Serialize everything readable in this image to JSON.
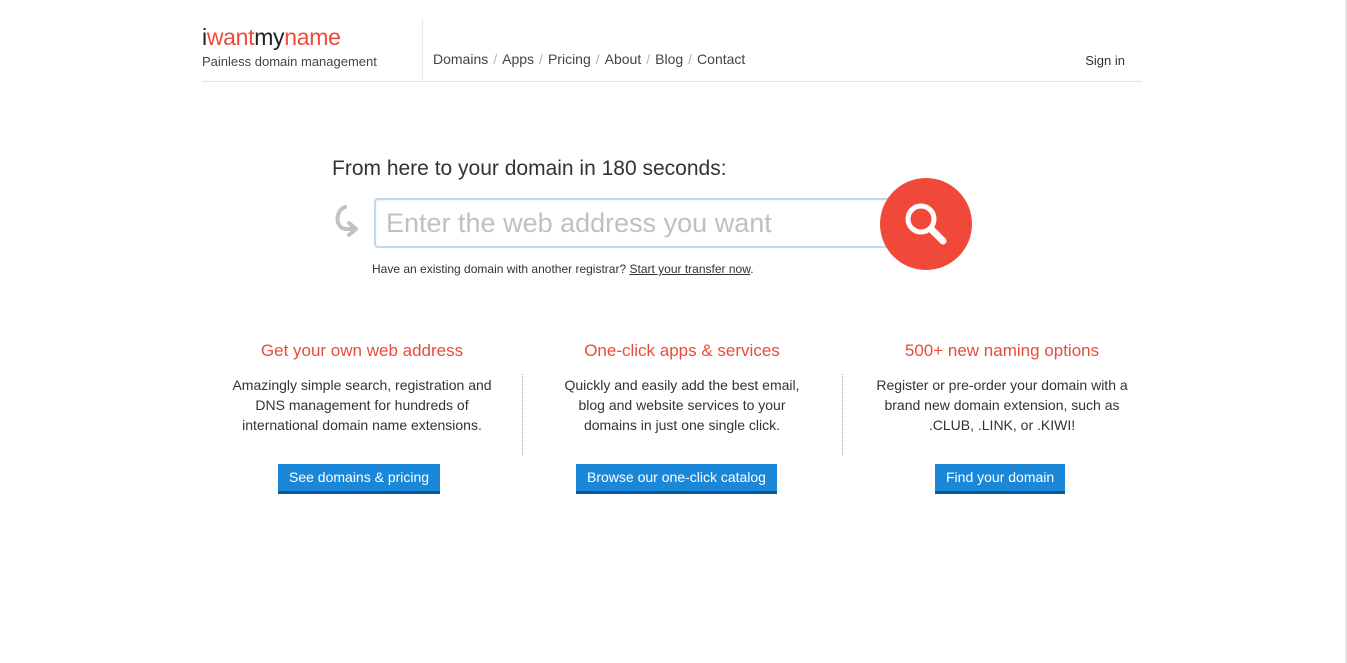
{
  "header": {
    "logo": {
      "part1": "i",
      "part2": "want",
      "part3": "my",
      "part4": "name"
    },
    "tagline": "Painless domain management",
    "nav": [
      "Domains",
      "Apps",
      "Pricing",
      "About",
      "Blog",
      "Contact"
    ],
    "nav_separator": "/",
    "signin": "Sign in"
  },
  "hero": {
    "title": "From here to your domain in 180 seconds:",
    "search_placeholder": "Enter the web address you want",
    "transfer_text": "Have an existing domain with another registrar?",
    "transfer_link": "Start your transfer now",
    "transfer_period": "."
  },
  "features": [
    {
      "title": "Get your own web address",
      "desc": "Amazingly simple search, registration and DNS management for hundreds of international domain name extensions.",
      "button": "See domains & pricing"
    },
    {
      "title": "One-click apps & services",
      "desc": "Quickly and easily add the best email, blog and website services to your domains in just one single click.",
      "button": "Browse our one-click catalog"
    },
    {
      "title": "500+ new naming options",
      "desc": "Register or pre-order your domain with a brand new domain extension, such as .CLUB, .LINK, or .KIWI!",
      "button": "Find your domain"
    }
  ],
  "colors": {
    "brand_red": "#f0493a",
    "button_blue": "#1b87d8",
    "heading_red": "#e94b3c"
  },
  "icons": {
    "search": "magnifier-icon",
    "hook": "hook-arrow-icon"
  }
}
